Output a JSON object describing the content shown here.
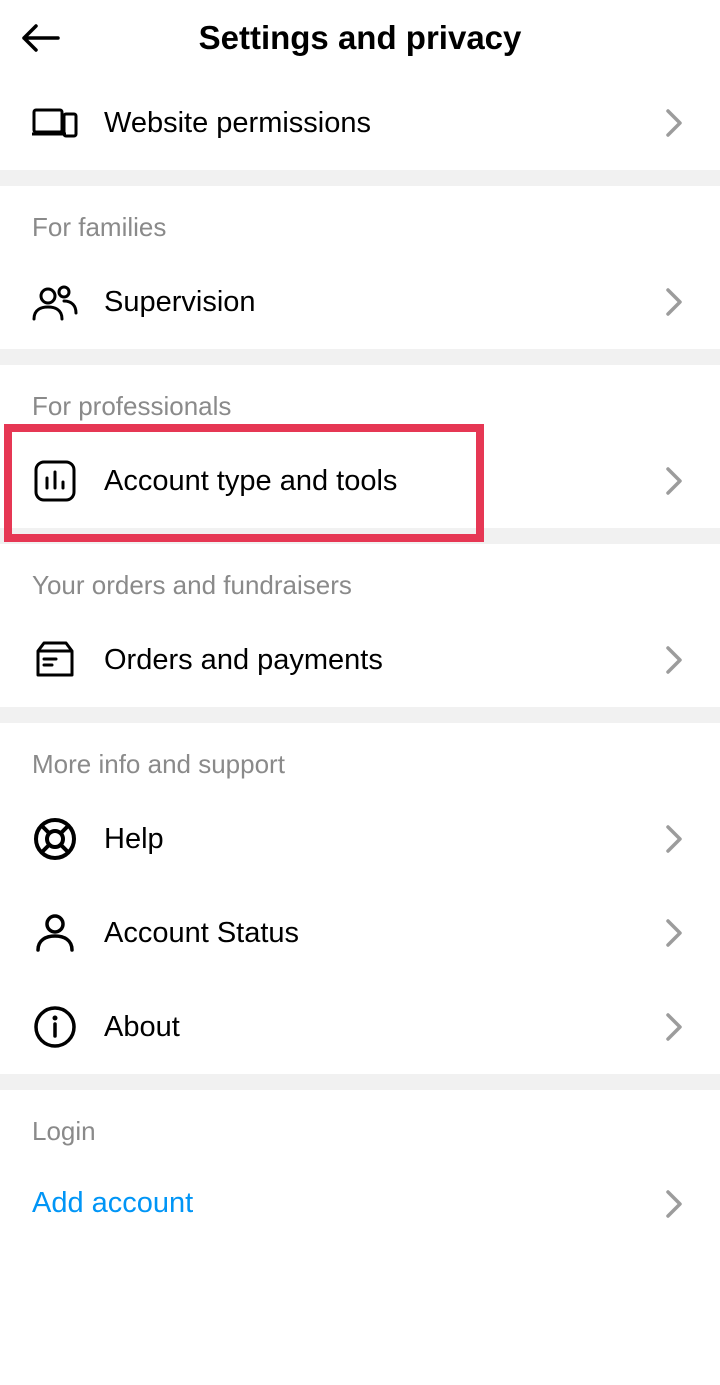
{
  "header": {
    "title": "Settings and privacy"
  },
  "sections": {
    "websitePermissions": "Website permissions",
    "forFamilies": "For families",
    "supervision": "Supervision",
    "forProfessionals": "For professionals",
    "accountTypeTools": "Account type and tools",
    "yourOrdersFundraisers": "Your orders and fundraisers",
    "ordersPayments": "Orders and payments",
    "moreInfoSupport": "More info and support",
    "help": "Help",
    "accountStatus": "Account Status",
    "about": "About",
    "login": "Login",
    "addAccount": "Add account"
  },
  "highlight": {
    "target": "account-type-tools-item",
    "color": "#e63754"
  }
}
